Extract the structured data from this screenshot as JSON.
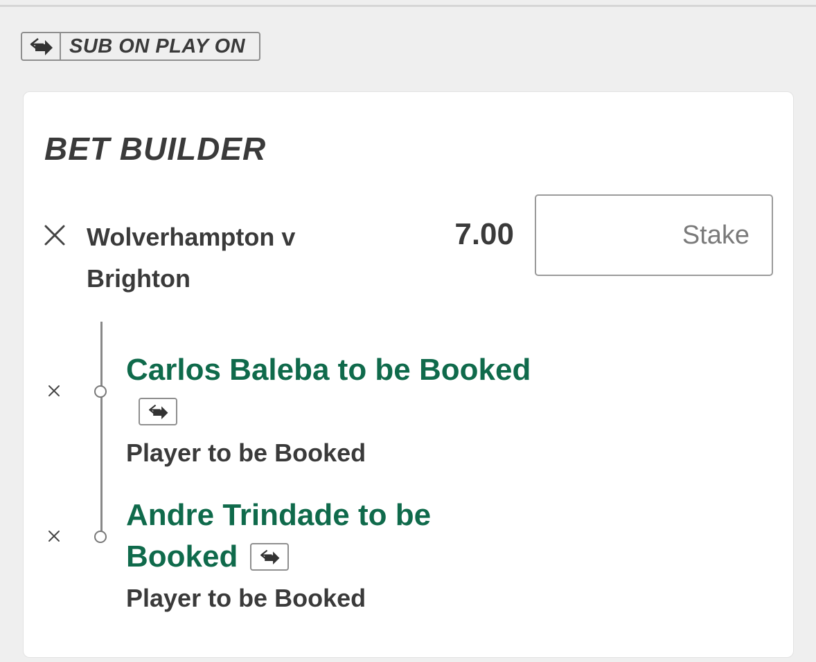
{
  "sub_on_play_on": {
    "label": "SUB ON PLAY ON",
    "icon": "substitution-swap-icon"
  },
  "bet_builder": {
    "title": "BET BUILDER",
    "event": {
      "line1": "Wolverhampton v",
      "line2": "Brighton",
      "odds": "7.00",
      "stake_placeholder": "Stake",
      "stake_value": ""
    },
    "legs": [
      {
        "selection": "Carlos Baleba to be Booked",
        "market": "Player to be Booked",
        "icon": "substitution-swap-icon"
      },
      {
        "selection_line1": "Andre Trindade to be",
        "selection_line2": "Booked",
        "market": "Player to be Booked",
        "icon": "substitution-swap-icon"
      }
    ]
  },
  "colors": {
    "background": "#efefef",
    "card": "#ffffff",
    "selection_green": "#0f6a4b",
    "text_dark": "#3a3a3a",
    "border_gray": "#8e8e8e"
  }
}
